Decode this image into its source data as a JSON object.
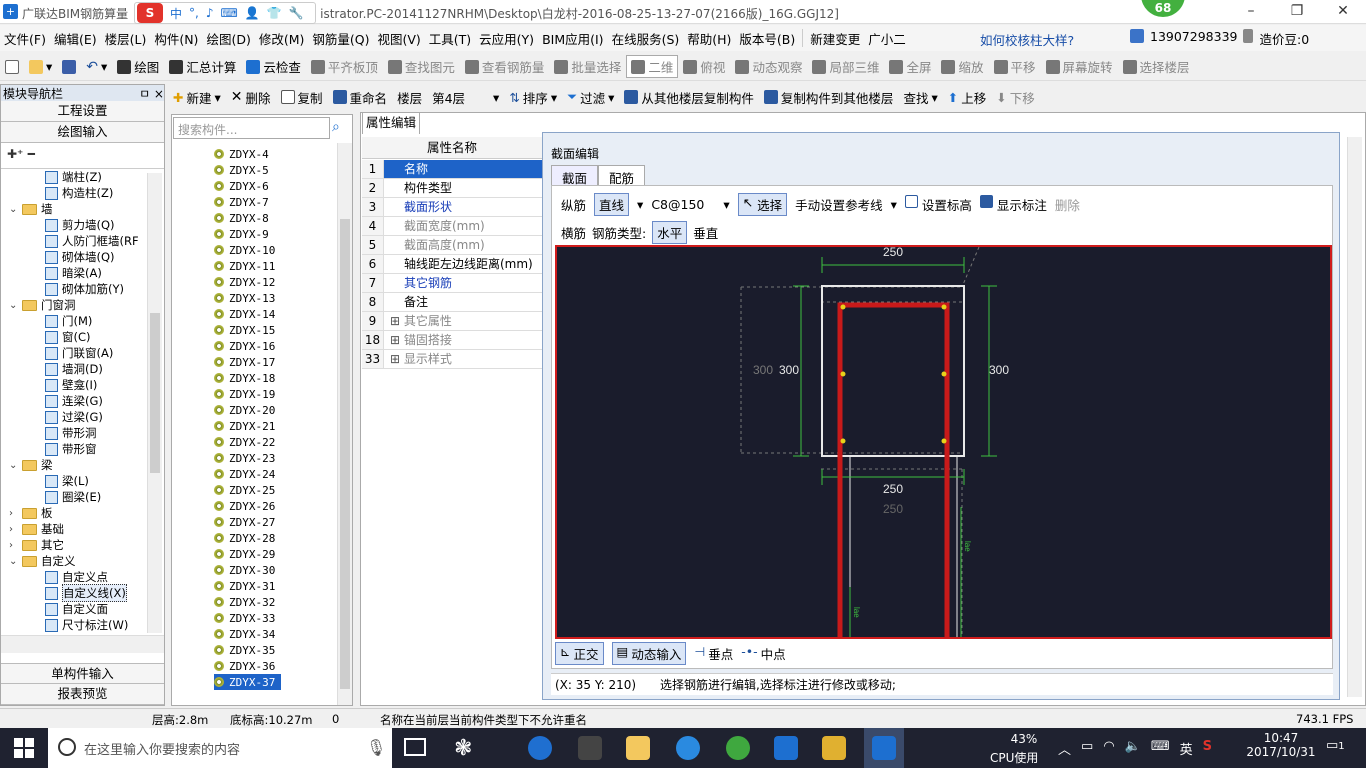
{
  "window": {
    "title": "广联达BIM钢筋算量",
    "title_path": "istrator.PC-20141127NRHM\\Desktop\\白龙村-2016-08-25-13-27-07(2166版)_16G.GGJ12]",
    "badge": "68",
    "ime": {
      "logo": "S",
      "mode": "中"
    }
  },
  "menu": [
    "文件(F)",
    "编辑(E)",
    "楼层(L)",
    "构件(N)",
    "绘图(D)",
    "修改(M)",
    "钢筋量(Q)",
    "视图(V)",
    "工具(T)",
    "云应用(Y)",
    "BIM应用(I)",
    "在线服务(S)",
    "帮助(H)",
    "版本号(B)",
    "新建变更",
    "广小二"
  ],
  "menu_right": {
    "help_link": "如何校核柱大样?",
    "phone": "13907298339",
    "bean": "造价豆:0"
  },
  "toolbar1": [
    "绘图",
    "汇总计算",
    "云检查",
    "平齐板顶",
    "查找图元",
    "查看钢筋量",
    "批量选择",
    "二维",
    "俯视",
    "动态观察",
    "局部三维",
    "全屏",
    "缩放",
    "平移",
    "屏幕旋转",
    "选择楼层"
  ],
  "toolbar2": {
    "new": "新建",
    "delete": "删除",
    "copy": "复制",
    "rename": "重命名",
    "floor_label": "楼层",
    "floor": "第4层",
    "sort": "排序",
    "filter": "过滤",
    "copy_from": "从其他楼层复制构件",
    "copy_to": "复制构件到其他楼层",
    "find": "查找",
    "up": "上移",
    "down": "下移"
  },
  "nav": {
    "header": "模块导航栏",
    "pin": "ㅁ ×",
    "btn_settings": "工程设置",
    "btn_draw": "绘图输入",
    "btn_single": "单构件输入",
    "btn_report": "报表预览",
    "tree": [
      {
        "label": "端柱(Z)",
        "level": 2
      },
      {
        "label": "构造柱(Z)",
        "level": 2
      },
      {
        "label": "墙",
        "level": 1,
        "folder": true,
        "exp": "⌄"
      },
      {
        "label": "剪力墙(Q)",
        "level": 2
      },
      {
        "label": "人防门框墙(RF",
        "level": 2
      },
      {
        "label": "砌体墙(Q)",
        "level": 2
      },
      {
        "label": "暗梁(A)",
        "level": 2
      },
      {
        "label": "砌体加筋(Y)",
        "level": 2
      },
      {
        "label": "门窗洞",
        "level": 1,
        "folder": true,
        "exp": "⌄"
      },
      {
        "label": "门(M)",
        "level": 2
      },
      {
        "label": "窗(C)",
        "level": 2
      },
      {
        "label": "门联窗(A)",
        "level": 2
      },
      {
        "label": "墙洞(D)",
        "level": 2
      },
      {
        "label": "壁龛(I)",
        "level": 2
      },
      {
        "label": "连梁(G)",
        "level": 2
      },
      {
        "label": "过梁(G)",
        "level": 2
      },
      {
        "label": "带形洞",
        "level": 2
      },
      {
        "label": "带形窗",
        "level": 2
      },
      {
        "label": "梁",
        "level": 1,
        "folder": true,
        "exp": "⌄"
      },
      {
        "label": "梁(L)",
        "level": 2
      },
      {
        "label": "圈梁(E)",
        "level": 2
      },
      {
        "label": "板",
        "level": 1,
        "folder": true,
        "exp": "›"
      },
      {
        "label": "基础",
        "level": 1,
        "folder": true,
        "exp": "›"
      },
      {
        "label": "其它",
        "level": 1,
        "folder": true,
        "exp": "›"
      },
      {
        "label": "自定义",
        "level": 1,
        "folder": true,
        "exp": "⌄"
      },
      {
        "label": "自定义点",
        "level": 2
      },
      {
        "label": "自定义线(X)",
        "level": 2,
        "selected": true
      },
      {
        "label": "自定义面",
        "level": 2
      },
      {
        "label": "尺寸标注(W)",
        "level": 2
      }
    ]
  },
  "components": {
    "search_placeholder": "搜索构件...",
    "items": [
      "ZDYX-4",
      "ZDYX-5",
      "ZDYX-6",
      "ZDYX-7",
      "ZDYX-8",
      "ZDYX-9",
      "ZDYX-10",
      "ZDYX-11",
      "ZDYX-12",
      "ZDYX-13",
      "ZDYX-14",
      "ZDYX-15",
      "ZDYX-16",
      "ZDYX-17",
      "ZDYX-18",
      "ZDYX-19",
      "ZDYX-20",
      "ZDYX-21",
      "ZDYX-22",
      "ZDYX-23",
      "ZDYX-24",
      "ZDYX-25",
      "ZDYX-26",
      "ZDYX-27",
      "ZDYX-28",
      "ZDYX-29",
      "ZDYX-30",
      "ZDYX-31",
      "ZDYX-32",
      "ZDYX-33",
      "ZDYX-34",
      "ZDYX-35",
      "ZDYX-36",
      "ZDYX-37"
    ],
    "selected": "ZDYX-37"
  },
  "props": {
    "tab": "属性编辑",
    "header": "属性名称",
    "rows": [
      {
        "num": "1",
        "name": "名称",
        "selected": true
      },
      {
        "num": "2",
        "name": "构件类型"
      },
      {
        "num": "3",
        "name": "截面形状",
        "blue": true
      },
      {
        "num": "4",
        "name": "截面宽度(mm)",
        "gray": true
      },
      {
        "num": "5",
        "name": "截面高度(mm)",
        "gray": true
      },
      {
        "num": "6",
        "name": "轴线距左边线距离(mm)"
      },
      {
        "num": "7",
        "name": "其它钢筋",
        "blue": true
      },
      {
        "num": "8",
        "name": "备注"
      },
      {
        "num": "9",
        "name": "其它属性",
        "gray": true,
        "plus": true
      },
      {
        "num": "18",
        "name": "锚固搭接",
        "gray": true,
        "plus": true
      },
      {
        "num": "33",
        "name": "显示样式",
        "gray": true,
        "plus": true
      }
    ]
  },
  "dialog": {
    "title": "截面编辑",
    "tab_section": "截面",
    "tab_rebar": "配筋",
    "long_label": "纵筋",
    "line_btn": "直线",
    "spec": "C8@150",
    "select_btn": "选择",
    "ref_line": "手动设置参考线",
    "set_elev": "设置标高",
    "show_dim": "显示标注",
    "delete": "删除",
    "trans_label": "横筋",
    "type_label": "钢筋类型:",
    "horizontal": "水平",
    "vertical": "垂直",
    "ortho": "正交",
    "dyn_input": "动态输入",
    "perp": "垂点",
    "mid": "中点",
    "coords": "(X: 35 Y: 210)",
    "hint": "选择钢筋进行编辑,选择标注进行修改或移动;"
  },
  "canvas": {
    "dim_top": "250",
    "dim_left_gray": "300",
    "dim_left": "300",
    "dim_right": "300",
    "dim_bottom": "250",
    "dim_bottom_gray": "250",
    "lae": "lae",
    "colors": {
      "bg": "#1a1c2c",
      "rebar": "#c81a1a",
      "dim": "#3fbf3f",
      "outline": "#e8e8e8",
      "border": "#d01c1c"
    }
  },
  "status": {
    "floor_h": "层高:2.8m",
    "base_h": "底标高:10.27m",
    "zero": "0",
    "message": "名称在当前层当前构件类型下不允许重名",
    "fps": "743.1 FPS"
  },
  "taskbar": {
    "search_placeholder": "在这里输入你要搜索的内容",
    "cpu_pct": "43%",
    "cpu_label": "CPU使用",
    "ime": "英",
    "time": "10:47",
    "date": "2017/10/31",
    "notif": "1"
  }
}
